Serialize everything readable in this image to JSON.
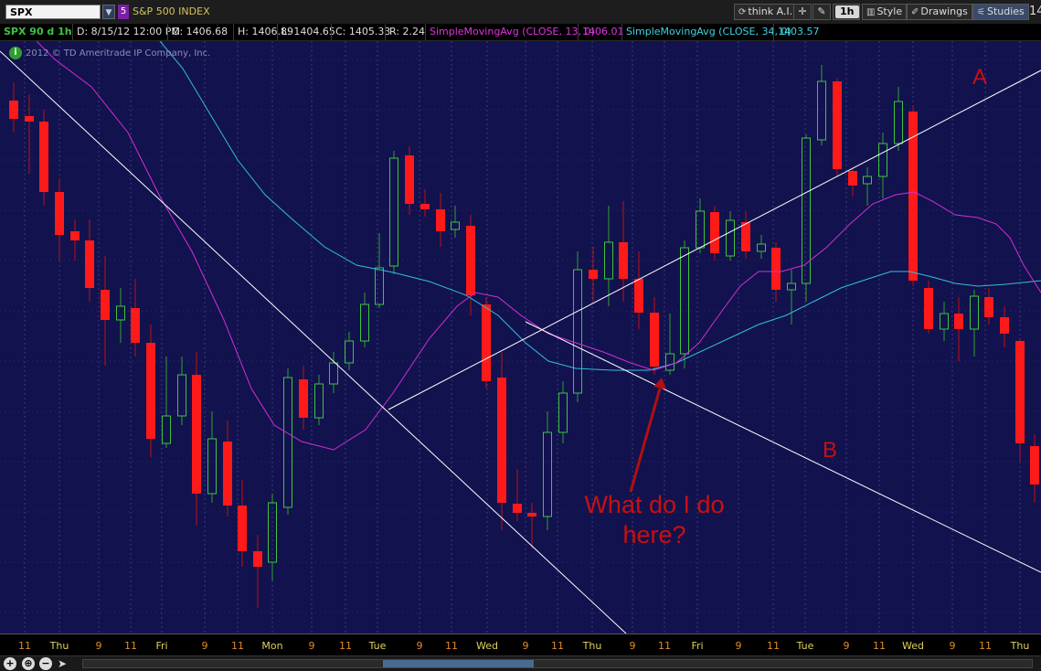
{
  "toolbar": {
    "symbol": "SPX",
    "link_number": "5",
    "description": "S&P 500 INDEX",
    "think_ai_label": "think A.I.",
    "timeframe_label": "1h",
    "style_label": "Style",
    "drawings_label": "Drawings",
    "studies_label": "Studies",
    "clipped_text": "14"
  },
  "info_bar": {
    "symbol_label": "SPX 90 d 1h",
    "date": "D: 8/15/12 12:00 PM",
    "open": "O: 1406.68",
    "high": "H: 1406.89",
    "low": "L: 1404.65",
    "close": "C: 1405.33",
    "range": "R: 2.24",
    "ma1_label": "SimpleMovingAvg (CLOSE, 13, 0)",
    "ma1_value": "1406.01",
    "ma2_label": "SimpleMovingAvg (CLOSE, 34, 0)",
    "ma2_value": "1403.57"
  },
  "copyright": "2012 © TD Ameritrade IP Company, Inc.",
  "annotations": {
    "label_a": "A",
    "label_b": "B",
    "question_line1": "What do I do",
    "question_line2": "here?"
  },
  "x_axis_labels": [
    "11",
    "Thu",
    "9",
    "11",
    "Fri",
    "9",
    "11",
    "Mon",
    "9",
    "11",
    "Tue",
    "9",
    "11",
    "Wed",
    "9",
    "11",
    "Thu",
    "9",
    "11",
    "Fri",
    "9",
    "11",
    "Tue",
    "9",
    "11",
    "Wed",
    "9",
    "11",
    "Thu"
  ],
  "colors": {
    "background": "#12124e",
    "up_candle": "#3ec43e",
    "down_candle": "#ff1a1a",
    "ma13": "#d030d0",
    "ma34": "#30c0d8",
    "trendlines": "#ffffff",
    "annotation": "#c81010"
  },
  "chart_data": {
    "type": "candlestick",
    "series": [
      {
        "name": "SimpleMovingAvg (CLOSE, 13, 0)",
        "last_value": 1406.01
      },
      {
        "name": "SimpleMovingAvg (CLOSE, 34, 0)",
        "last_value": 1403.57
      }
    ],
    "last_bar": {
      "date": "8/15/12 12:00 PM",
      "open": 1406.68,
      "high": 1406.89,
      "low": 1404.65,
      "close": 1405.33,
      "range": 2.24
    },
    "x_tick_labels": [
      "11",
      "Thu",
      "9",
      "11",
      "Fri",
      "9",
      "11",
      "Mon",
      "9",
      "11",
      "Tue",
      "9",
      "11",
      "Wed",
      "9",
      "11",
      "Thu",
      "9",
      "11",
      "Fri",
      "9",
      "11",
      "Tue",
      "9",
      "11",
      "Wed",
      "9",
      "11",
      "Thu"
    ],
    "annotations": [
      "A",
      "B",
      "What do I do here?"
    ]
  }
}
